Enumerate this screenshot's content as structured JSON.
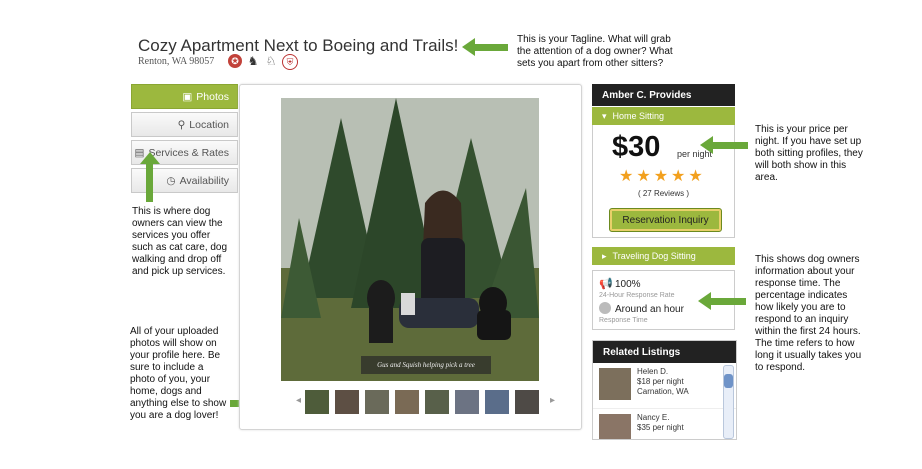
{
  "listing": {
    "title": "Cozy Apartment Next to Boeing and Trails!",
    "location": "Renton, WA 98057",
    "badges": [
      "ribbon-icon",
      "dog-icon",
      "dog-walk-icon",
      "shield-icon"
    ]
  },
  "tabs": [
    {
      "label": "Photos",
      "icon": "photo-icon",
      "active": true
    },
    {
      "label": "Location",
      "icon": "pin-icon"
    },
    {
      "label": "Services & Rates",
      "icon": "card-icon"
    },
    {
      "label": "Availability",
      "icon": "clock-icon"
    }
  ],
  "photo": {
    "caption": "Gus and Squish helping pick a tree"
  },
  "provides": {
    "header": "Amber C. Provides",
    "home_sitting": "Home Sitting",
    "price": "$30",
    "per_night": "per night",
    "reviews": "( 27 Reviews )",
    "reserve": "Reservation Inquiry",
    "traveling": "Traveling Dog Sitting"
  },
  "response": {
    "percent": "100%",
    "percent_label": "24-Hour Response Rate",
    "time": "Around an hour",
    "time_label": "Response Time"
  },
  "related": {
    "header": "Related Listings",
    "items": [
      {
        "name": "Helen D.",
        "price": "$18 per night",
        "city": "Carnation, WA"
      },
      {
        "name": "Nancy E.",
        "price": "$35 per night",
        "city": ""
      }
    ]
  },
  "notes": {
    "tagline": [
      "This is your Tagline. What will grab",
      "the attention of a dog owner? What",
      "sets you apart from other sitters?"
    ],
    "price": [
      "This is your price per",
      "night. If you have set up",
      "both sitting profiles, they",
      "will both show in this",
      "area."
    ],
    "services": [
      "This is where dog",
      "owners can view the",
      "services you offer",
      "such as cat care, dog",
      "walking and drop off",
      "and pick up services."
    ],
    "response": [
      "This shows dog owners",
      "information about your",
      "response time. The",
      "percentage indicates",
      "how likely you are to",
      "respond to an inquiry",
      "within the first 24 hours.",
      "The time refers to how",
      "long it usually takes you",
      "to respond."
    ],
    "photos": [
      "All of your uploaded",
      "photos will show on",
      "your profile here. Be",
      "sure to include a",
      "photo of you,  your",
      "home, dogs and",
      "anything else to show",
      "you are a dog lover!"
    ]
  },
  "colors": {
    "accent_green": "#9cb83e",
    "arrow_green": "#6aa83a",
    "star": "#f2a01e",
    "dark_header": "#222222"
  }
}
